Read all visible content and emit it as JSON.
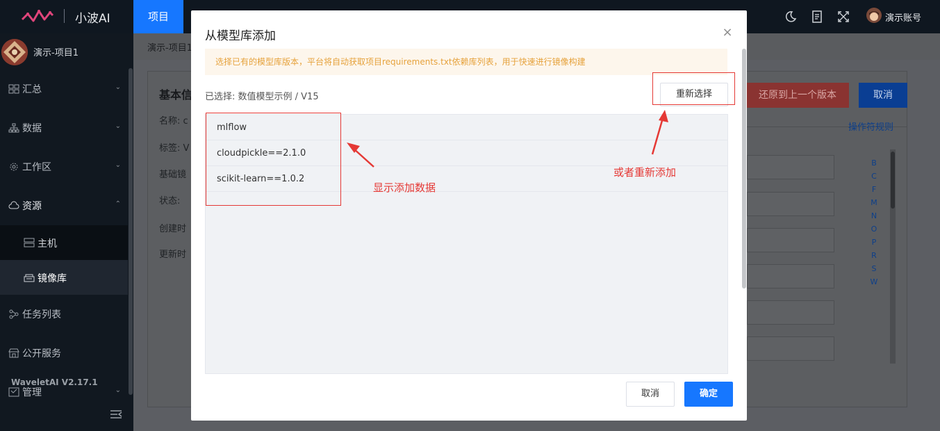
{
  "topbar": {
    "brand": "小波AI",
    "active_tab": "项目",
    "user_name": "演示账号",
    "icons": [
      "moon-icon",
      "document-icon",
      "fullscreen-icon"
    ]
  },
  "sidebar": {
    "project_name": "演示-项目1",
    "items": [
      {
        "label": "汇总",
        "icon": "grid-icon"
      },
      {
        "label": "数据",
        "icon": "hierarchy-icon"
      },
      {
        "label": "工作区",
        "icon": "gear-icon"
      },
      {
        "label": "资源",
        "icon": "cloud-icon"
      },
      {
        "label": "主机",
        "icon": "server-icon"
      },
      {
        "label": "镜像库",
        "icon": "image-repo-icon"
      },
      {
        "label": "任务列表",
        "icon": "workflow-icon"
      },
      {
        "label": "公开服务",
        "icon": "store-icon"
      },
      {
        "label": "管理",
        "icon": "manage-icon"
      }
    ],
    "version": "WaveletAI V2.17.1"
  },
  "background": {
    "breadcrumb": "演示-项目1",
    "section_title": "基本信",
    "labels": [
      "名称:",
      "标签:",
      "基础镜",
      "状态:",
      "创建时",
      "更新时"
    ],
    "label_values": [
      "c",
      "V"
    ],
    "restore_button": "还原到上一个版本",
    "cancel_button": "取消",
    "rule_link": "操作符规则",
    "letters": [
      "B",
      "C",
      "F",
      "M",
      "N",
      "O",
      "P",
      "R",
      "S",
      "W"
    ]
  },
  "modal": {
    "title": "从模型库添加",
    "alert": "选择已有的模型库版本，平台将自动获取项目requirements.txt依赖库列表，用于快速进行镜像构建",
    "selected_prefix": "已选择: ",
    "selected_value": "数值模型示例 / V15",
    "reselect_button": "重新选择",
    "packages": [
      "mlflow",
      "cloudpickle==2.1.0",
      "scikit-learn==1.0.2"
    ],
    "cancel_button": "取消",
    "ok_button": "确定"
  },
  "annotations": {
    "list_note": "显示添加数据",
    "reselect_note": "或者重新添加",
    "color": "#e53935"
  }
}
